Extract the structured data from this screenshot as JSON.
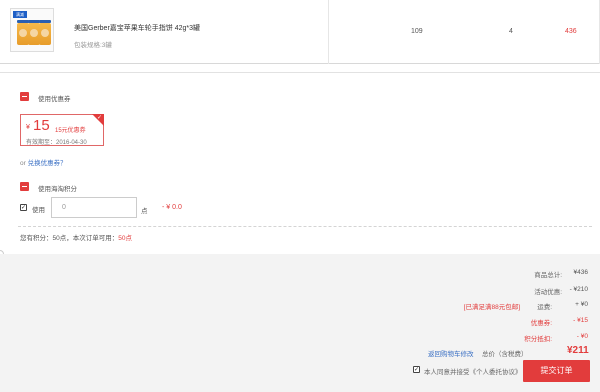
{
  "product": {
    "badge": "满减",
    "name": "美国Gerber嘉宝苹果车轮手指饼 42g*3罐",
    "spec": "包装规格:3罐",
    "price": "109",
    "qty": "4",
    "subtotal": "436"
  },
  "coupon_section": {
    "label": "使用优惠券",
    "coupon": {
      "currency": "¥",
      "amount": "15",
      "desc": "15元优惠券",
      "expiry": "有效期至：2016-04-30"
    },
    "or_text": "or",
    "exchange_link": "兑换优惠券？"
  },
  "points_section": {
    "label": "使用海淘积分",
    "use_label": "使用",
    "input_value": "0",
    "unit": "点",
    "deduct": "- ¥ 0.0",
    "info_prefix": "您有积分：50点，本次订单可用：",
    "info_available": "50点"
  },
  "summary": {
    "goods_total_label": "商品总计:",
    "goods_total": "¥436",
    "promo_label": "活动优惠:",
    "promo": "- ¥210",
    "free_ship_note": "[已满足满88元包邮]",
    "ship_label": "运费:",
    "ship": "+ ¥0",
    "coupon_label": "优惠券:",
    "coupon": "- ¥15",
    "points_label": "积分抵扣:",
    "points": "- ¥0",
    "back_link": "返回购物车修改",
    "total_label": "总价（含税费）",
    "total": "¥211",
    "agree_text": "本人同意并接受《个人委托协议》",
    "submit": "提交订单"
  },
  "colors": {
    "accent": "#e23c3c",
    "link": "#3b70c4",
    "summary_bg": "#f3f3f3"
  }
}
